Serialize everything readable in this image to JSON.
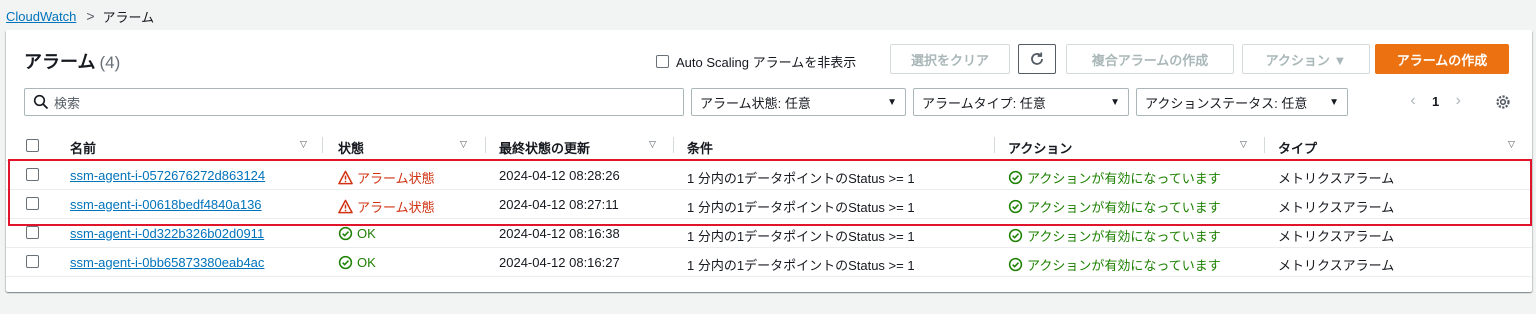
{
  "breadcrumb": {
    "root": "CloudWatch",
    "current": "アラーム"
  },
  "header": {
    "title": "アラーム",
    "count": "(4)"
  },
  "toolbar": {
    "hide_autoscaling": "Auto Scaling アラームを非表示",
    "clear_selection": "選択をクリア",
    "create_composite": "複合アラームの作成",
    "actions": "アクション ▼",
    "create_alarm": "アラームの作成"
  },
  "search": {
    "placeholder": "検索"
  },
  "filters": {
    "state": "アラーム状態: 任意",
    "type": "アラームタイプ: 任意",
    "action_status": "アクションステータス: 任意"
  },
  "pagination": {
    "page": "1"
  },
  "columns": [
    "名前",
    "状態",
    "最終状態の更新",
    "条件",
    "アクション",
    "タイプ"
  ],
  "rows": [
    {
      "name": "ssm-agent-i-0572676272d863124",
      "state": "アラーム状態",
      "state_kind": "alarm",
      "updated": "2024-04-12 08:28:26",
      "condition": "1 分内の1データポイントのStatus >= 1",
      "action": "アクションが有効になっています",
      "type": "メトリクスアラーム"
    },
    {
      "name": "ssm-agent-i-00618bedf4840a136",
      "state": "アラーム状態",
      "state_kind": "alarm",
      "updated": "2024-04-12 08:27:11",
      "condition": "1 分内の1データポイントのStatus >= 1",
      "action": "アクションが有効になっています",
      "type": "メトリクスアラーム"
    },
    {
      "name": "ssm-agent-i-0d322b326b02d0911",
      "state": "OK",
      "state_kind": "ok",
      "updated": "2024-04-12 08:16:38",
      "condition": "1 分内の1データポイントのStatus >= 1",
      "action": "アクションが有効になっています",
      "type": "メトリクスアラーム"
    },
    {
      "name": "ssm-agent-i-0bb65873380eab4ac",
      "state": "OK",
      "state_kind": "ok",
      "updated": "2024-04-12 08:16:27",
      "condition": "1 分内の1データポイントのStatus >= 1",
      "action": "アクションが有効になっています",
      "type": "メトリクスアラーム"
    }
  ],
  "colors": {
    "alarm": "#d13212",
    "ok": "#1d8102",
    "link": "#0073bb",
    "primary": "#ec7211",
    "highlight": "#e0142a"
  }
}
